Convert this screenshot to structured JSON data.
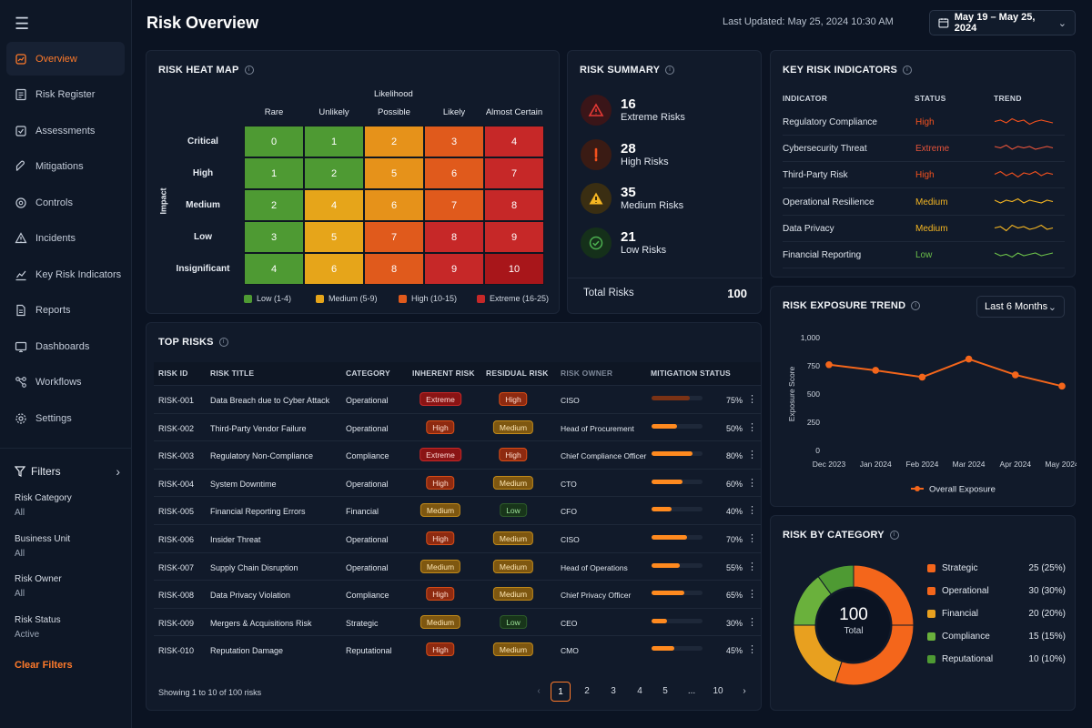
{
  "nav": {
    "items": [
      {
        "label": "Overview",
        "icon": "overview-icon"
      },
      {
        "label": "Risk Register",
        "icon": "register-icon"
      },
      {
        "label": "Assessments",
        "icon": "assessments-icon"
      },
      {
        "label": "Mitigations",
        "icon": "mitigations-icon"
      },
      {
        "label": "Controls",
        "icon": "controls-icon"
      },
      {
        "label": "Incidents",
        "icon": "incidents-icon"
      },
      {
        "label": "Key Risk Indicators",
        "icon": "kri-icon"
      },
      {
        "label": "Reports",
        "icon": "reports-icon"
      },
      {
        "label": "Dashboards",
        "icon": "dashboards-icon"
      },
      {
        "label": "Workflows",
        "icon": "workflows-icon"
      },
      {
        "label": "Settings",
        "icon": "settings-icon"
      }
    ]
  },
  "filters": {
    "title": "Filters",
    "groups": [
      {
        "label": "Risk Category",
        "value": "All"
      },
      {
        "label": "Business Unit",
        "value": "All"
      },
      {
        "label": "Risk Owner",
        "value": "All"
      },
      {
        "label": "Risk Status",
        "value": "Active"
      }
    ],
    "clear": "Clear Filters"
  },
  "header": {
    "title": "Risk Overview",
    "updated": "Last Updated: May 25, 2024 10:30 AM",
    "daterange": "May 19 – May 25, 2024"
  },
  "heatmap": {
    "title": "RISK HEAT MAP",
    "x_title": "Likelihood",
    "y_title": "Impact",
    "cols": [
      "Rare",
      "Unlikely",
      "Possible",
      "Likely",
      "Almost Certain"
    ],
    "rows": [
      "Critical",
      "High",
      "Medium",
      "Low",
      "Insignificant"
    ],
    "cells": [
      [
        0,
        1,
        2,
        3,
        4
      ],
      [
        1,
        2,
        5,
        6,
        7
      ],
      [
        2,
        4,
        6,
        7,
        8
      ],
      [
        3,
        5,
        7,
        8,
        9
      ],
      [
        4,
        6,
        8,
        9,
        10
      ]
    ],
    "colors": [
      [
        "#4e9a33",
        "#4e9a33",
        "#e6921a",
        "#e05a1c",
        "#c62828"
      ],
      [
        "#4e9a33",
        "#4e9a33",
        "#e6921a",
        "#e05a1c",
        "#c62828"
      ],
      [
        "#4e9a33",
        "#e6a51a",
        "#e6921a",
        "#e05a1c",
        "#c62828"
      ],
      [
        "#4e9a33",
        "#e6a51a",
        "#e05a1c",
        "#c62828",
        "#c62828"
      ],
      [
        "#4e9a33",
        "#e6a51a",
        "#e05a1c",
        "#c62828",
        "#a8161a"
      ]
    ],
    "legend": [
      {
        "label": "Low (1-4)",
        "color": "#4e9a33"
      },
      {
        "label": "Medium (5-9)",
        "color": "#e6a51a"
      },
      {
        "label": "High (10-15)",
        "color": "#e05a1c"
      },
      {
        "label": "Extreme (16-25)",
        "color": "#c62828"
      }
    ]
  },
  "summary": {
    "title": "RISK SUMMARY",
    "items": [
      {
        "num": "16",
        "label": "Extreme Risks",
        "icon": "warning-triangle-icon",
        "color": "#e53935",
        "bg": "#3a1518"
      },
      {
        "num": "28",
        "label": "High Risks",
        "icon": "exclamation-icon",
        "color": "#f4511e",
        "bg": "#3a1b14"
      },
      {
        "num": "35",
        "label": "Medium Risks",
        "icon": "caution-icon",
        "color": "#f5b622",
        "bg": "#3a2e12"
      },
      {
        "num": "21",
        "label": "Low Risks",
        "icon": "check-circle-icon",
        "color": "#4caf50",
        "bg": "#15301a"
      }
    ],
    "total_label": "Total Risks",
    "total": "100"
  },
  "kri": {
    "title": "KEY RISK INDICATORS",
    "headers": [
      "INDICATOR",
      "STATUS",
      "TREND"
    ],
    "rows": [
      {
        "name": "Regulatory Compliance",
        "status": "High",
        "color": "#f4511e",
        "spark": [
          5,
          6,
          4,
          7,
          5,
          6,
          3,
          5,
          6,
          5,
          4
        ]
      },
      {
        "name": "Cybersecurity Threat",
        "status": "Extreme",
        "color": "#e5533a",
        "spark": [
          6,
          5,
          7,
          4,
          6,
          5,
          6,
          4,
          5,
          6,
          5
        ]
      },
      {
        "name": "Third-Party Risk",
        "status": "High",
        "color": "#f4511e",
        "spark": [
          5,
          7,
          4,
          6,
          3,
          6,
          5,
          7,
          4,
          6,
          5
        ]
      },
      {
        "name": "Operational Resilience",
        "status": "Medium",
        "color": "#f5b622",
        "spark": [
          6,
          4,
          6,
          5,
          7,
          4,
          6,
          5,
          4,
          6,
          5
        ]
      },
      {
        "name": "Data Privacy",
        "status": "Medium",
        "color": "#f5b622",
        "spark": [
          5,
          6,
          3,
          7,
          5,
          6,
          4,
          5,
          7,
          4,
          5
        ]
      },
      {
        "name": "Financial Reporting",
        "status": "Low",
        "color": "#6cc04a",
        "spark": [
          6,
          4,
          5,
          3,
          6,
          4,
          5,
          6,
          4,
          5,
          6
        ]
      }
    ]
  },
  "top_risks": {
    "title": "TOP RISKS",
    "headers": [
      "RISK ID",
      "RISK TITLE",
      "CATEGORY",
      "INHERENT RISK",
      "RESIDUAL RISK",
      "RISK OWNER",
      "MITIGATION STATUS"
    ],
    "rows": [
      {
        "id": "RISK-001",
        "title": "Data Breach due to Cyber Attack",
        "category": "Operational",
        "inherent": "Extreme",
        "residual": "High",
        "owner": "CISO",
        "progress": 75,
        "pct": "75%"
      },
      {
        "id": "RISK-002",
        "title": "Third-Party Vendor Failure",
        "category": "Operational",
        "inherent": "High",
        "residual": "Medium",
        "owner": "Head of Procurement",
        "progress": 50,
        "pct": "50%"
      },
      {
        "id": "RISK-003",
        "title": "Regulatory Non-Compliance",
        "category": "Compliance",
        "inherent": "Extreme",
        "residual": "High",
        "owner": "Chief Compliance Officer",
        "progress": 80,
        "pct": "80%"
      },
      {
        "id": "RISK-004",
        "title": "System Downtime",
        "category": "Operational",
        "inherent": "High",
        "residual": "Medium",
        "owner": "CTO",
        "progress": 60,
        "pct": "60%"
      },
      {
        "id": "RISK-005",
        "title": "Financial Reporting Errors",
        "category": "Financial",
        "inherent": "Medium",
        "residual": "Low",
        "owner": "CFO",
        "progress": 40,
        "pct": "40%"
      },
      {
        "id": "RISK-006",
        "title": "Insider Threat",
        "category": "Operational",
        "inherent": "High",
        "residual": "Medium",
        "owner": "CISO",
        "progress": 70,
        "pct": "70%"
      },
      {
        "id": "RISK-007",
        "title": "Supply Chain Disruption",
        "category": "Operational",
        "inherent": "Medium",
        "residual": "Medium",
        "owner": "Head of Operations",
        "progress": 55,
        "pct": "55%"
      },
      {
        "id": "RISK-008",
        "title": "Data Privacy Violation",
        "category": "Compliance",
        "inherent": "High",
        "residual": "Medium",
        "owner": "Chief Privacy Officer",
        "progress": 65,
        "pct": "65%"
      },
      {
        "id": "RISK-009",
        "title": "Mergers & Acquisitions Risk",
        "category": "Strategic",
        "inherent": "Medium",
        "residual": "Low",
        "owner": "CEO",
        "progress": 30,
        "pct": "30%"
      },
      {
        "id": "RISK-010",
        "title": "Reputation Damage",
        "category": "Reputational",
        "inherent": "High",
        "residual": "Medium",
        "owner": "CMO",
        "progress": 45,
        "pct": "45%"
      }
    ],
    "footer": "Showing 1 to 10 of 100 risks",
    "pages": [
      "1",
      "2",
      "3",
      "4",
      "5",
      "...",
      "10"
    ],
    "current_page": "1"
  },
  "trend": {
    "title": "RISK EXPOSURE TREND",
    "dropdown": "Last 6 Months"
  },
  "chart_data": {
    "type": "line",
    "x": [
      "Dec 2023",
      "Jan 2024",
      "Feb 2024",
      "Mar 2024",
      "Apr 2024",
      "May 2024"
    ],
    "series": [
      {
        "name": "Overall Exposure",
        "values": [
          760,
          710,
          650,
          810,
          670,
          570
        ],
        "color": "#f4661b"
      }
    ],
    "ylabel": "Exposure Score",
    "ylim": [
      0,
      1000
    ],
    "yticks": [
      "0",
      "250",
      "500",
      "750",
      "1,000"
    ],
    "legend": "bottom"
  },
  "category": {
    "title": "RISK BY CATEGORY",
    "total": "100",
    "total_label": "Total",
    "items": [
      {
        "label": "Strategic",
        "value": 25,
        "text": "25 (25%)",
        "color": "#f4661b"
      },
      {
        "label": "Operational",
        "value": 30,
        "text": "30 (30%)",
        "color": "#f4661b"
      },
      {
        "label": "Financial",
        "value": 20,
        "text": "20 (20%)",
        "color": "#e8a01f"
      },
      {
        "label": "Compliance",
        "value": 15,
        "text": "15 (15%)",
        "color": "#6ab13c"
      },
      {
        "label": "Reputational",
        "value": 10,
        "text": "10 (10%)",
        "color": "#4e9a33"
      }
    ]
  }
}
